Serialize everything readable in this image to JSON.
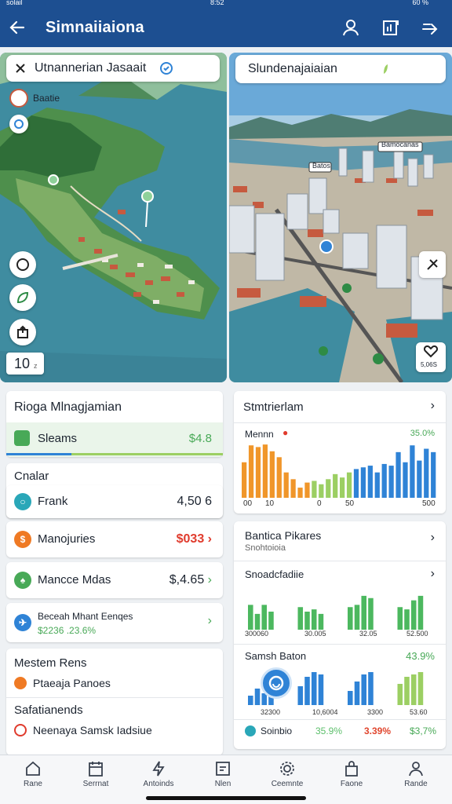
{
  "status_bar": {
    "left": "solail",
    "center": "8:52",
    "right": "60 %"
  },
  "app_bar": {
    "title": "Simnaiiaiona"
  },
  "map_left": {
    "label": "Utnannerian Jasaait",
    "pin_label": "Baatie",
    "zoom_value": "10",
    "zoom_suffix": "z"
  },
  "map_right": {
    "label": "Slundenajaiaian",
    "callout_1": "Bamocanas",
    "callout_2": "Batos",
    "corner_badge": "5,06S"
  },
  "left_panel": {
    "header_card": {
      "title": "Rioga Mlnagjamian",
      "selected_label": "Sleams",
      "selected_value": "$4.8"
    },
    "section_1": {
      "title": "Cnalar"
    },
    "rows": [
      {
        "label": "Frank",
        "value": "4,50 6",
        "value_color": "#1c2430",
        "dot_color": "#2aa7b8",
        "dot_icon": "circle-icon"
      },
      {
        "label": "Manojuries",
        "value": "$033",
        "value_color": "#e03b2d",
        "dot_color": "#ef7a24",
        "dot_icon": "dollar-icon"
      },
      {
        "label": "Mancce Mdas",
        "value": "$,4.65",
        "value_color": "#1c2430",
        "dot_color": "#48a957",
        "dot_icon": "leaf-icon"
      }
    ],
    "promo": {
      "line1": "Beceah Mhant Eenqes",
      "line2": "$2236 .23.6%",
      "line2_suffix": "%"
    },
    "section_2": {
      "title": "Mestem Rens",
      "item": "Ptaeaja Panoes"
    },
    "section_3": {
      "title": "Safatianends",
      "item": "Neenaya Samsk Iadsiue"
    }
  },
  "right_panel": {
    "card1": {
      "title": "Stmtrierlam",
      "legend_label": "Mennn",
      "legend_value": "35.0%",
      "axis": [
        "00",
        "10",
        "0",
        "50",
        "500"
      ]
    },
    "card2": {
      "title": "Bantica Pikares",
      "subtitle": "Snohtoioia",
      "sub_title": "Snoadcfadiie",
      "mini_labels": [
        "300060",
        "30.005",
        "32.05",
        "52.500"
      ]
    },
    "card3": {
      "title": "Samsh Baton",
      "value": "43.9%",
      "mini_labels": [
        "32300",
        "10,6004",
        "3300",
        "53.60"
      ],
      "footer_label": "Soinbio",
      "footer_values": [
        "35.9%",
        "3.39%",
        "$3,7%"
      ],
      "footer_colors": [
        "#5cbf6b",
        "#e0452d",
        "#48a957"
      ]
    }
  },
  "chart_data": [
    {
      "type": "bar",
      "title": "",
      "xlabel": "",
      "ylabel": "",
      "series": [
        {
          "name": "Mennn",
          "values": [
            42,
            62,
            60,
            63,
            55,
            48,
            30,
            22,
            12,
            18,
            20,
            16,
            22,
            28,
            24,
            30,
            34,
            36,
            38,
            30,
            40,
            38,
            54,
            42,
            62,
            44,
            58,
            54
          ]
        }
      ],
      "colors": [
        "#f0962a",
        "#9ccf63",
        "#2f83d6"
      ],
      "axis_ticks": [
        "00",
        "10",
        "0",
        "50",
        "500"
      ]
    },
    {
      "type": "bar",
      "title": "",
      "xlabel": "",
      "ylabel": "",
      "groups": [
        [
          22,
          14,
          22,
          16
        ],
        [
          20,
          16,
          18,
          14
        ],
        [
          20,
          22,
          30,
          28
        ],
        [
          20,
          18,
          26,
          30
        ]
      ],
      "colors": [
        "#4cb85f"
      ]
    },
    {
      "type": "bar",
      "title": "",
      "xlabel": "",
      "ylabel": "",
      "groups": [
        [
          8,
          14,
          10,
          18
        ],
        [
          16,
          24,
          28,
          26
        ],
        [
          12,
          20,
          26,
          28
        ],
        [
          18,
          24,
          26,
          28
        ]
      ],
      "colors": [
        "#2f83d6",
        "#9ccf63"
      ]
    }
  ],
  "nav": [
    {
      "label": "Rane",
      "icon": "home-icon"
    },
    {
      "label": "Serrnat",
      "icon": "calendar-icon"
    },
    {
      "label": "Antoinds",
      "icon": "bolt-icon"
    },
    {
      "label": "Nlen",
      "icon": "note-icon"
    },
    {
      "label": "Ceemnte",
      "icon": "settings-icon"
    },
    {
      "label": "Faone",
      "icon": "bag-icon"
    },
    {
      "label": "Rande",
      "icon": "profile-icon"
    }
  ],
  "colors": {
    "appbar": "#1d4f91",
    "accent_green": "#48a957",
    "accent_red": "#e03b2d",
    "accent_blue": "#2f83d6"
  }
}
